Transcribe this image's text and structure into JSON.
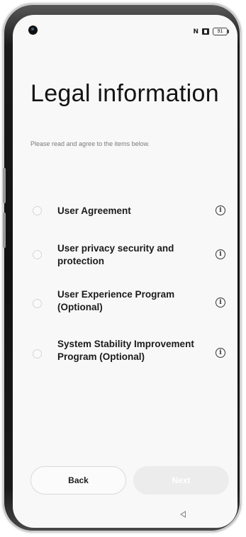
{
  "status_bar": {
    "nfc_icon": "nfc-icon",
    "sim_icon": "sim-card-icon",
    "battery_level": "91"
  },
  "page": {
    "title": "Legal information",
    "subtitle": "Please read and agree to the items below."
  },
  "items": [
    {
      "label": "User Agreement",
      "checked": false
    },
    {
      "label": "User privacy security and protection",
      "checked": false
    },
    {
      "label": "User Experience Program (Optional)",
      "checked": false
    },
    {
      "label": "System Stability Improvement Program (Optional)",
      "checked": false
    }
  ],
  "buttons": {
    "back_label": "Back",
    "next_label": "Next",
    "next_enabled": false
  },
  "colors": {
    "background": "#f8f8f8",
    "text": "#141414",
    "subtitle": "#7a7a7a",
    "next_disabled_bg": "#ececec"
  }
}
